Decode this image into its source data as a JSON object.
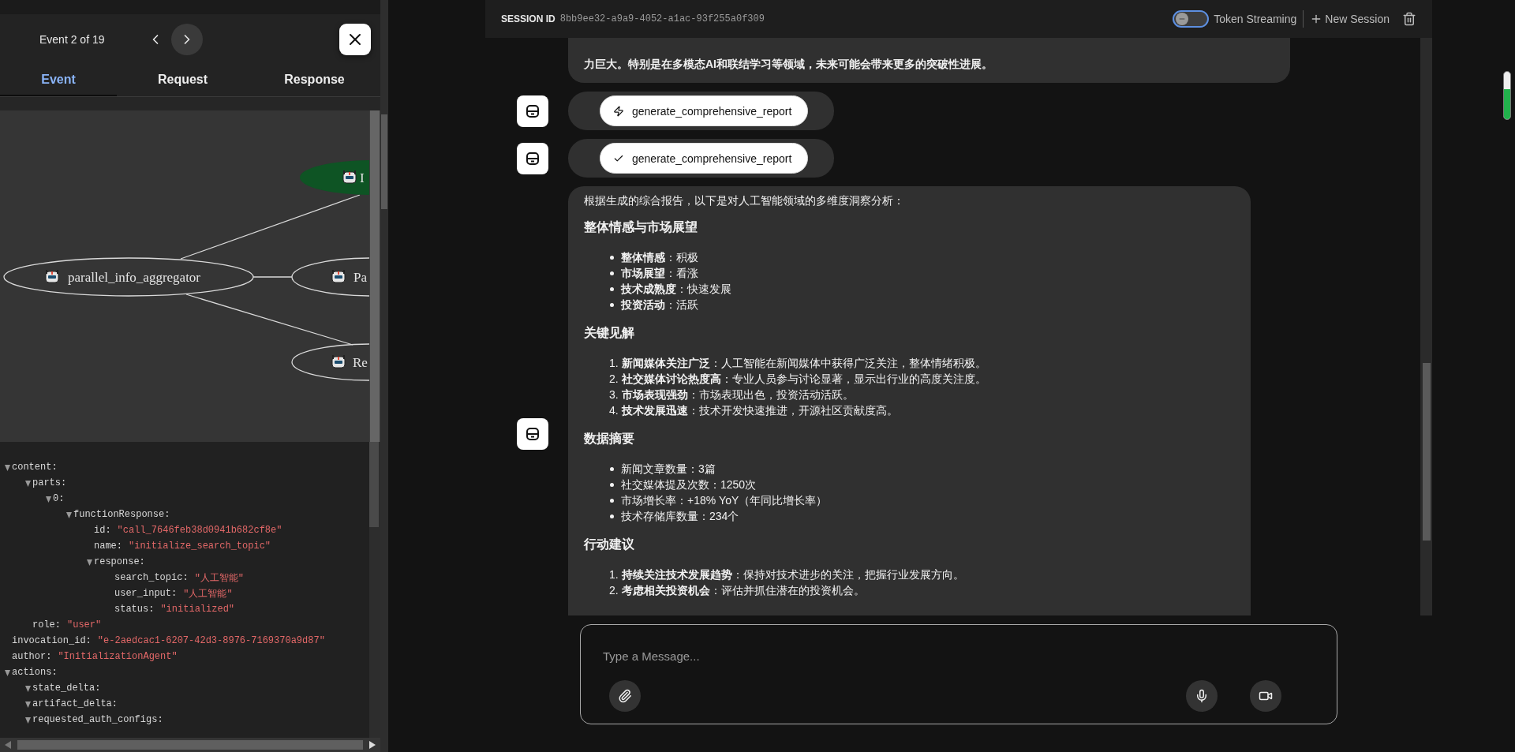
{
  "event_panel": {
    "counter": "Event 2 of 19",
    "tabs": [
      {
        "label": "Event",
        "selected": true
      },
      {
        "label": "Request",
        "selected": false
      },
      {
        "label": "Response",
        "selected": false
      }
    ],
    "graph_nodes": [
      {
        "label": "I",
        "kind": "active"
      },
      {
        "label": "parallel_info_aggregator",
        "kind": "normal"
      },
      {
        "label": "Pa",
        "kind": "normal"
      },
      {
        "label": "Re",
        "kind": "normal"
      }
    ],
    "tree": [
      {
        "key": "content:",
        "expanded": true,
        "children": [
          {
            "key": "parts:",
            "expanded": true,
            "children": [
              {
                "key": "0:",
                "expanded": true,
                "children": [
                  {
                    "key": "functionResponse:",
                    "expanded": true,
                    "children": [
                      {
                        "key": "id:",
                        "value": "\"call_7646feb38d0941b682cf8e\""
                      },
                      {
                        "key": "name:",
                        "value": "\"initialize_search_topic\""
                      },
                      {
                        "key": "response:",
                        "expanded": true,
                        "children": [
                          {
                            "key": "search_topic:",
                            "value": "\"人工智能\""
                          },
                          {
                            "key": "user_input:",
                            "value": "\"人工智能\""
                          },
                          {
                            "key": "status:",
                            "value": "\"initialized\""
                          }
                        ]
                      }
                    ]
                  }
                ]
              }
            ]
          },
          {
            "key": "role:",
            "value": "\"user\""
          }
        ]
      },
      {
        "key": "invocation_id:",
        "value": "\"e-2aedcac1-6207-42d3-8976-7169370a9d87\""
      },
      {
        "key": "author:",
        "value": "\"InitializationAgent\""
      },
      {
        "key": "actions:",
        "expanded": true,
        "children": [
          {
            "key": "state_delta:",
            "expanded": true
          },
          {
            "key": "artifact_delta:",
            "expanded": true
          },
          {
            "key": "requested_auth_configs:",
            "expanded": true
          }
        ]
      }
    ]
  },
  "session": {
    "label": "SESSION ID",
    "id": "8bb9ee32-a9a9-4052-a1ac-93f255a0f309",
    "token_streaming": {
      "label": "Token Streaming",
      "on": false
    },
    "new_session": "New Session"
  },
  "messages": [
    {
      "kind": "text",
      "text": "力巨大。特别是在多模态AI和联结学习等领域，未来可能会带来更多的突破性进展。"
    },
    {
      "kind": "call",
      "name": "generate_comprehensive_report"
    },
    {
      "kind": "result",
      "name": "generate_comprehensive_report"
    },
    {
      "kind": "report",
      "blocks": [
        {
          "kind": "paragraph",
          "text": "根据生成的综合报告，以下是对人工智能领域的多维度洞察分析："
        },
        {
          "kind": "heading",
          "text": "整体情感与市场展望"
        },
        {
          "kind": "bullets",
          "items": [
            "**整体情感**：积极",
            "**市场展望**：看涨",
            "**技术成熟度**：快速发展",
            "**投资活动**：活跃"
          ]
        },
        {
          "kind": "heading",
          "text": "关键见解"
        },
        {
          "kind": "numbered",
          "items": [
            "1. **新闻媒体关注广泛**：人工智能在新闻媒体中获得广泛关注，整体情绪积极。",
            "2. **社交媒体讨论热度高**：专业人员参与讨论显著，显示出行业的高度关注度。",
            "3. **市场表现强劲**：市场表现出色，投资活动活跃。",
            "4. **技术发展迅速**：技术开发快速推进，开源社区贡献度高。"
          ]
        },
        {
          "kind": "heading",
          "text": "数据摘要"
        },
        {
          "kind": "bullets",
          "items": [
            "新闻文章数量：3篇",
            "社交媒体提及次数：1250次",
            "市场增长率：+18% YoY（年同比增长率）",
            "技术存储库数量：234个"
          ]
        },
        {
          "kind": "heading",
          "text": "行动建议"
        },
        {
          "kind": "numbered",
          "items": [
            "1. **持续关注技术发展趋势**：保持对技术进步的关注，把握行业发展方向。",
            "2. **考虑相关投资机会**：评估并抓住潜在的投资机会。"
          ]
        }
      ]
    }
  ],
  "composer": {
    "placeholder": "Type a Message..."
  }
}
